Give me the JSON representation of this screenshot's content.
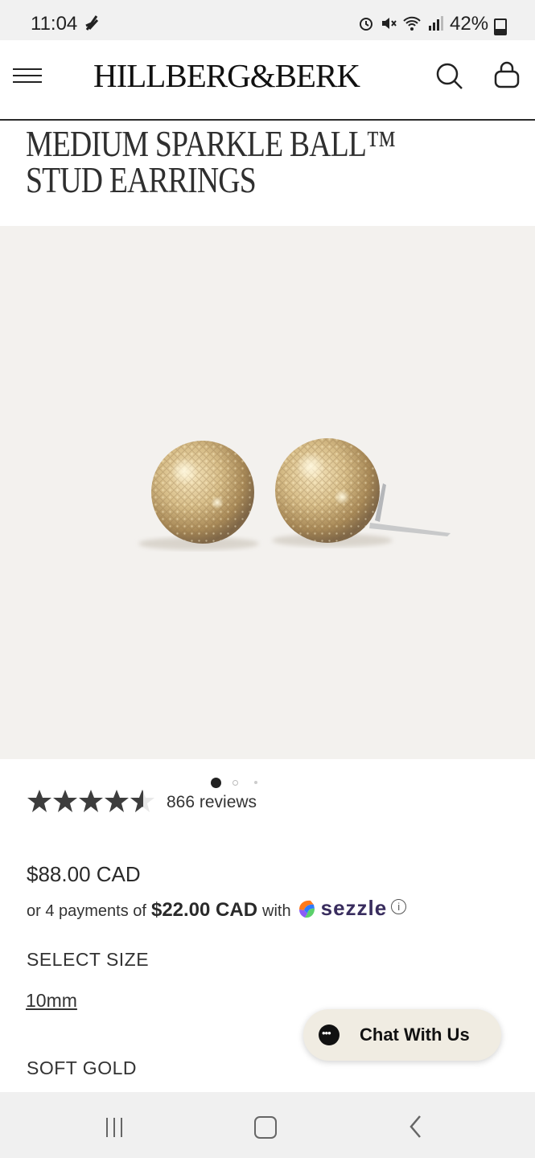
{
  "status_bar": {
    "time": "11:04",
    "battery": "42%"
  },
  "header": {
    "brand": "HILLBERG&BERK",
    "menu_icon": "hamburger-menu-icon",
    "search_icon": "search-icon",
    "bag_icon": "shopping-bag-icon"
  },
  "product": {
    "title": "MEDIUM SPARKLE BALL™ STUD EARRINGS",
    "image": "earrings-product-image",
    "carousel": {
      "total": 3,
      "active": 1
    },
    "rating": {
      "stars": 4.6,
      "max": 5,
      "reviews_text": "866 reviews"
    },
    "price": "$88.00 CAD",
    "payments": {
      "prefix": "or 4 payments of",
      "amount": "$22.00 CAD",
      "suffix": "with",
      "provider": "sezzle"
    },
    "size_label": "SELECT SIZE",
    "size_option": "10mm",
    "color_label": "SOFT GOLD"
  },
  "chat": {
    "label": "Chat With Us"
  },
  "colors": {
    "page_bg": "#ffffff",
    "image_bg": "#f3f1ee",
    "chat_bg": "#f0ece2",
    "sezzle": "#392d5e"
  }
}
